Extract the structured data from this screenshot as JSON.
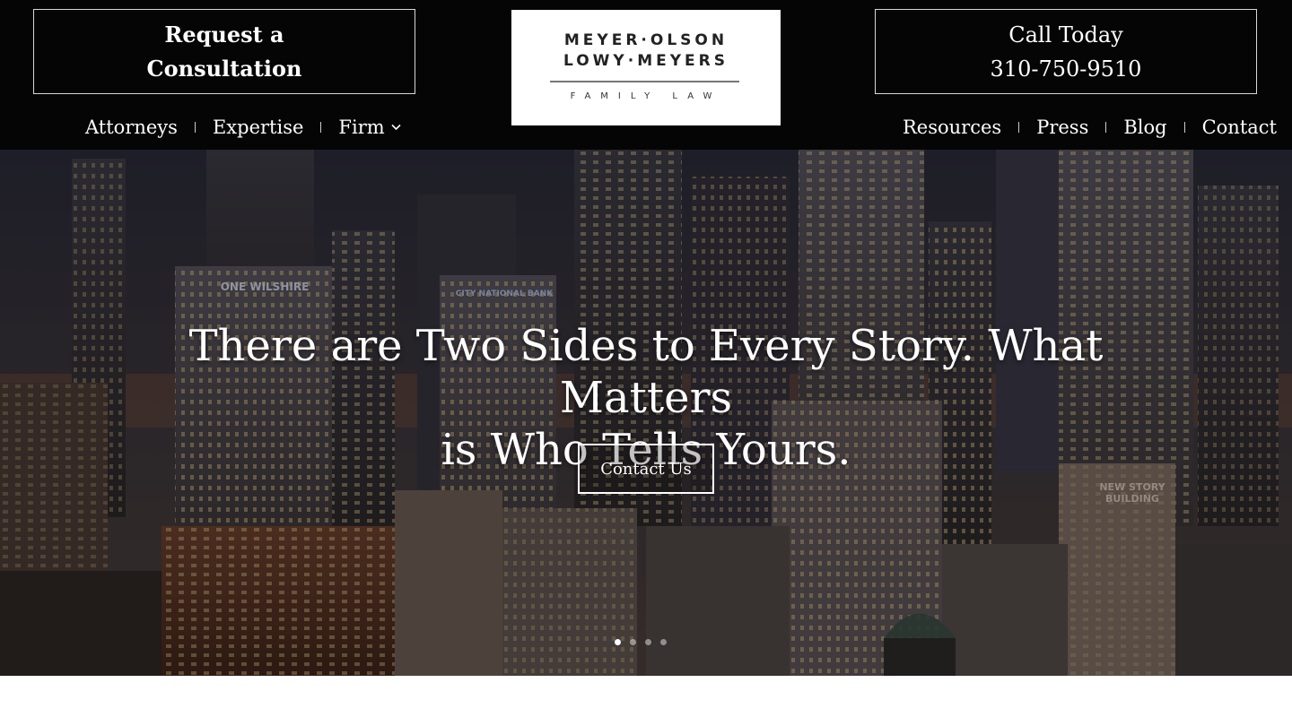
{
  "header": {
    "consultation": {
      "line1": "Request a",
      "line2": "Consultation"
    },
    "call": {
      "line1": "Call Today",
      "phone": "310-750-9510"
    },
    "logo": {
      "line1": "MEYER·OLSON",
      "line2": "LOWY·MEYERS",
      "line3": "FAMILY LAW"
    }
  },
  "nav": {
    "left": [
      {
        "label": "Attorneys"
      },
      {
        "label": "Expertise"
      },
      {
        "label": "Firm",
        "has_dropdown": true
      }
    ],
    "right": [
      {
        "label": "Resources"
      },
      {
        "label": "Press"
      },
      {
        "label": "Blog"
      },
      {
        "label": "Contact"
      }
    ]
  },
  "hero": {
    "headline_line1": "There are Two Sides to Every Story. What Matters",
    "headline_line2": "is Who Tells Yours.",
    "cta_label": "Contact Us",
    "slides_total": 4,
    "active_slide": 1,
    "background": "downtown city skyline at dusk",
    "building_signs": [
      "ONE WILSHIRE",
      "CITY NATIONAL BANK",
      "NEW STORY BUILDING"
    ]
  },
  "colors": {
    "header_bg": "#050505",
    "text": "#ffffff",
    "border": "#d8d8d8",
    "logo_bg": "#ffffff"
  }
}
